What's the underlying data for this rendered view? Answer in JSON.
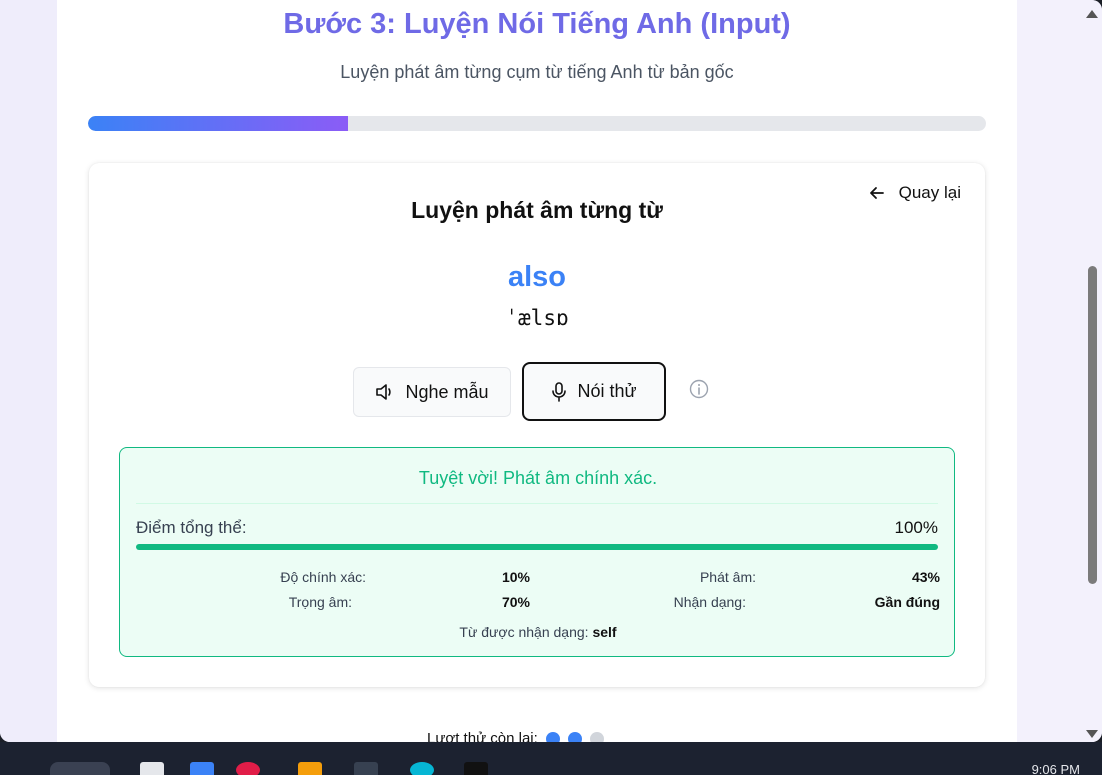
{
  "header": {
    "title": "Bước 3: Luyện Nói Tiếng Anh (Input)",
    "subtitle": "Luyện phát âm từng cụm từ tiếng Anh từ bản gốc",
    "progress_fraction": 0.29
  },
  "card": {
    "back_label": "Quay lại",
    "title": "Luyện phát âm từng từ",
    "word": "also",
    "ipa": "ˈælsɒ",
    "listen_label": "Nghe mẫu",
    "speak_label": "Nói thử"
  },
  "result": {
    "message": "Tuyệt vời! Phát âm chính xác.",
    "overall_label": "Điểm tổng thể:",
    "overall_value": "100%",
    "overall_fraction": 1.0,
    "accuracy_label": "Độ chính xác:",
    "accuracy_value": "10%",
    "pronunciation_label": "Phát âm:",
    "pronunciation_value": "43%",
    "stress_label": "Trọng âm:",
    "stress_value": "70%",
    "recognition_label": "Nhận dạng:",
    "recognition_value": "Gần đúng",
    "recognized_label": "Từ được nhận dạng:",
    "recognized_word": "self"
  },
  "attempts": {
    "label": "Lượt thử còn lại:",
    "dots": [
      "used",
      "used",
      "remaining"
    ]
  },
  "taskbar": {
    "clock": "9:06 PM"
  },
  "colors": {
    "accent_blue": "#3b82f6",
    "accent_purple": "#8b5cf6",
    "success": "#10b981",
    "title": "#6f6ae6"
  }
}
